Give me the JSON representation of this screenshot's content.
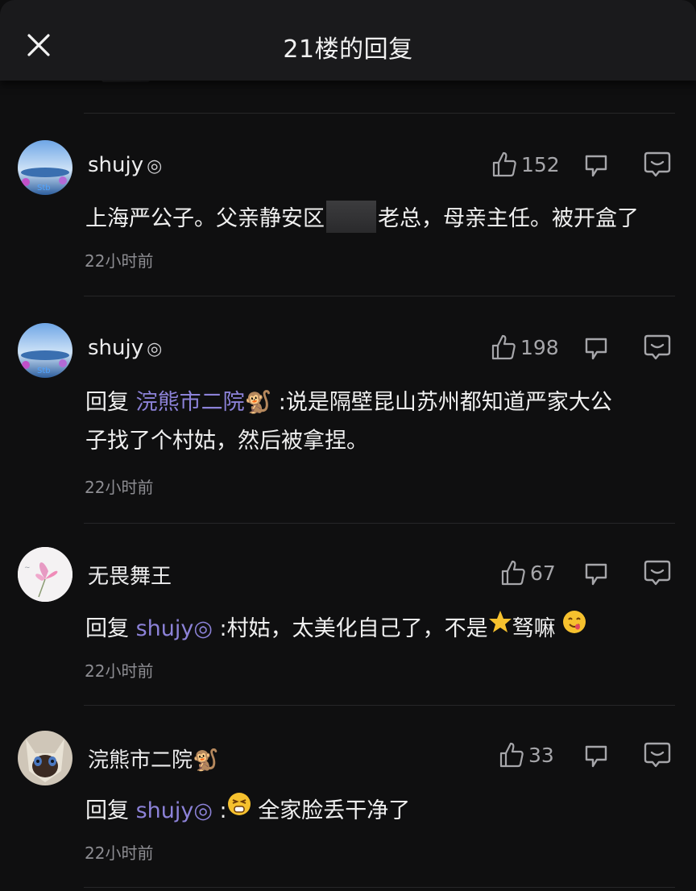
{
  "header": {
    "title": "21楼的回复",
    "close_icon": "close-icon"
  },
  "colors": {
    "background": "#0f0f10",
    "mention": "#8c82d8",
    "muted": "#8d8d92"
  },
  "comments": [
    {
      "user": "shujy",
      "badge": "◎",
      "likes": "152",
      "text_a": "上海严公子。父亲静安区",
      "text_b": "老总，母亲主任。被开盒了",
      "time": "22小时前"
    },
    {
      "user": "shujy",
      "badge": "◎",
      "likes": "198",
      "reply_prefix": "回复",
      "mention": "浣熊市二院🐒",
      "text_a": " :说是隔壁昆山苏州都知道严家大公",
      "text_b": "子找了个村姑，然后被拿捏。",
      "time": "22小时前"
    },
    {
      "user": "无畏舞王",
      "likes": "67",
      "reply_prefix": "回复",
      "mention": "shujy◎",
      "text_a": " :村姑，太美化自己了，不是",
      "text_b": "驽嘛",
      "time": "22小时前"
    },
    {
      "user": "浣熊市二院🐒",
      "likes": "33",
      "reply_prefix": "回复",
      "mention": "shujy◎",
      "text_a": " :",
      "text_b": "全家脸丢干净了",
      "time": "22小时前"
    }
  ]
}
